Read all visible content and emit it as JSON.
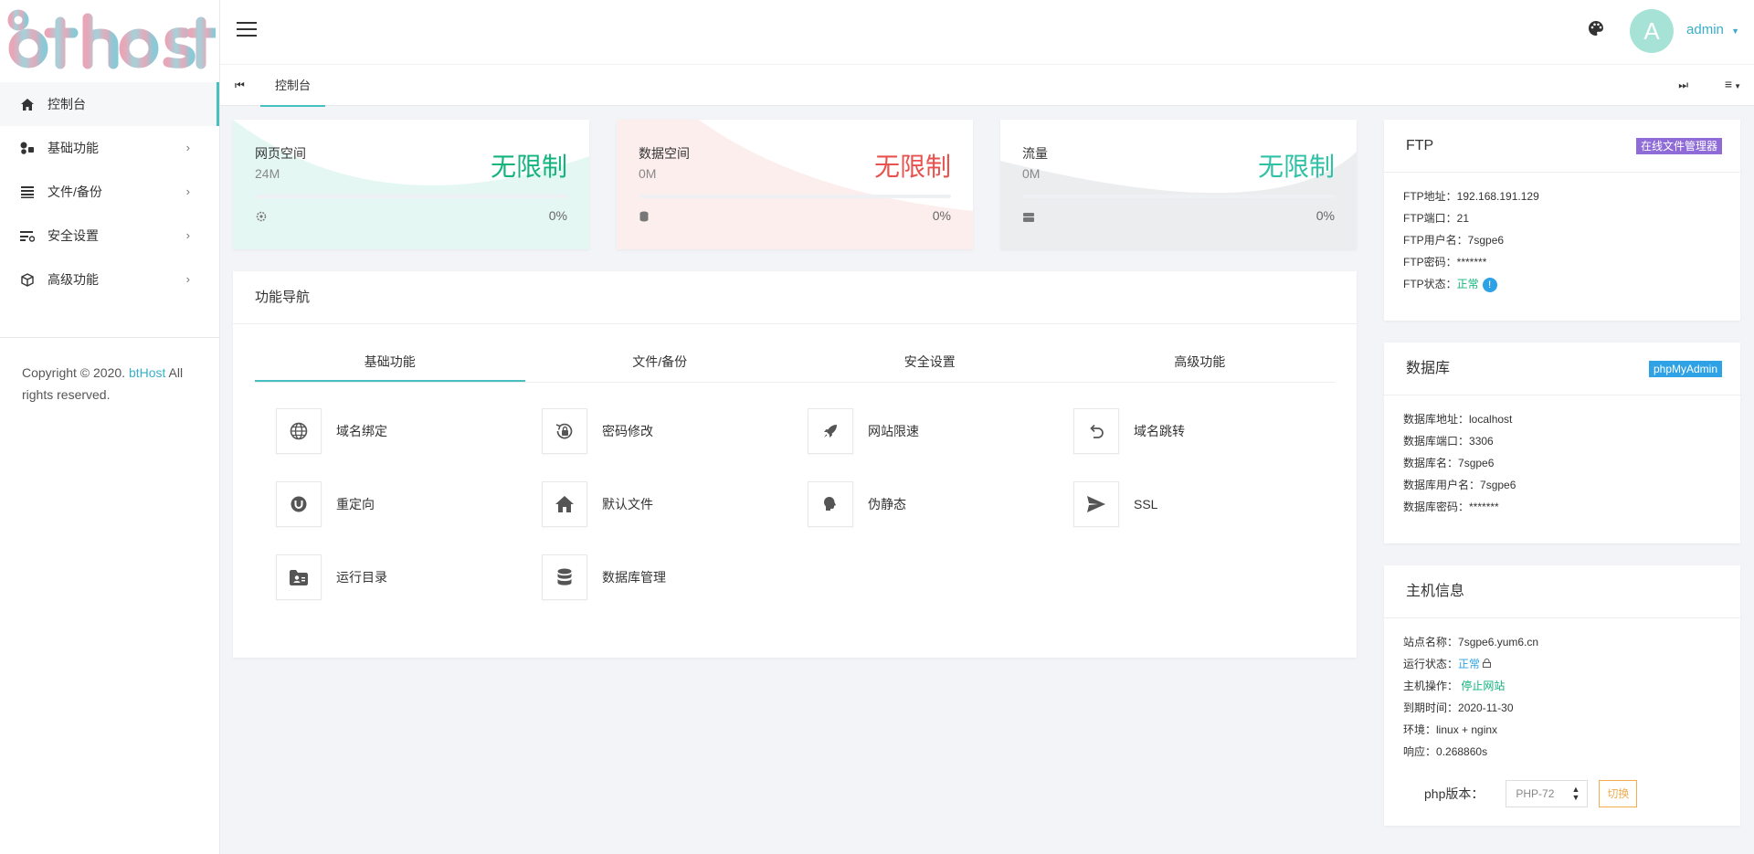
{
  "logo": {
    "text": "bthost"
  },
  "sidebar": {
    "items": [
      {
        "label": "控制台",
        "icon": "home-icon"
      },
      {
        "label": "基础功能",
        "icon": "shapes-icon"
      },
      {
        "label": "文件/备份",
        "icon": "list-icon"
      },
      {
        "label": "安全设置",
        "icon": "filter-icon"
      },
      {
        "label": "高级功能",
        "icon": "cube-icon"
      }
    ],
    "copyright_prefix": "Copyright © 2020.",
    "copyright_brand": "btHost",
    "copyright_suffix": "All rights reserved."
  },
  "header": {
    "avatar_letter": "A",
    "user": "admin"
  },
  "tabs": {
    "current": "控制台"
  },
  "stats": [
    {
      "label": "网页空间",
      "used": "24M",
      "limit": "无限制",
      "percent": "0%",
      "color": "#13b37c",
      "bg": "#e4f7f3"
    },
    {
      "label": "数据空间",
      "used": "0M",
      "limit": "无限制",
      "percent": "0%",
      "color": "#e8524e",
      "bg": "#fdeeee"
    },
    {
      "label": "流量",
      "used": "0M",
      "limit": "无限制",
      "percent": "0%",
      "color": "#2ec1a6",
      "bg": "#ecedef"
    }
  ],
  "func_nav": {
    "title": "功能导航",
    "tabs": [
      "基础功能",
      "文件/备份",
      "安全设置",
      "高级功能"
    ],
    "items": [
      {
        "label": "域名绑定",
        "icon": "globe-icon"
      },
      {
        "label": "密码修改",
        "icon": "lock-reset-icon"
      },
      {
        "label": "网站限速",
        "icon": "rocket-icon"
      },
      {
        "label": "域名跳转",
        "icon": "undo-icon"
      },
      {
        "label": "重定向",
        "icon": "redirect-icon"
      },
      {
        "label": "默认文件",
        "icon": "house-icon"
      },
      {
        "label": "伪静态",
        "icon": "brain-icon"
      },
      {
        "label": "SSL",
        "icon": "send-icon"
      },
      {
        "label": "运行目录",
        "icon": "folder-user-icon"
      },
      {
        "label": "数据库管理",
        "icon": "database-icon"
      }
    ]
  },
  "ftp": {
    "title": "FTP",
    "badge": "在线文件管理器",
    "address_label": "FTP地址：",
    "address": "192.168.191.129",
    "port_label": "FTP端口：",
    "port": "21",
    "user_label": "FTP用户名：",
    "user": "7sgpe6",
    "pass_label": "FTP密码：",
    "pass": "*******",
    "status_label": "FTP状态：",
    "status": "正常",
    "status_info": "!"
  },
  "db": {
    "title": "数据库",
    "badge": "phpMyAdmin",
    "address_label": "数据库地址：",
    "address": "localhost",
    "port_label": "数据库端口：",
    "port": "3306",
    "name_label": "数据库名：",
    "name": "7sgpe6",
    "user_label": "数据库用户名：",
    "user": "7sgpe6",
    "pass_label": "数据库密码：",
    "pass": "*******"
  },
  "host": {
    "title": "主机信息",
    "site_label": "站点名称：",
    "site": "7sgpe6.yum6.cn",
    "run_label": "运行状态：",
    "run": "正常",
    "op_label": "主机操作：",
    "op": "停止网站",
    "expire_label": "到期时间：",
    "expire": "2020-11-30",
    "env_label": "环境：",
    "env": "linux + nginx",
    "resp_label": "响应：",
    "resp": "0.268860s",
    "php_label": "php版本：",
    "php_value": "PHP-72",
    "switch": "切换"
  },
  "colors": {
    "accent": "#47c1bf",
    "link": "#3aaec8",
    "success": "#13b37c",
    "info": "#2ea2e4",
    "warning": "#f0ad4e",
    "purple": "#8e6bd6"
  }
}
